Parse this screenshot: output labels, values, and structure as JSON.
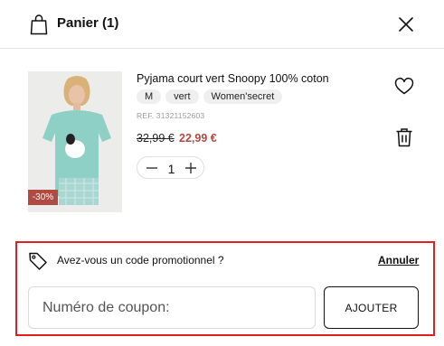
{
  "cart": {
    "title": "Panier (1)"
  },
  "item": {
    "name": "Pyjama court vert Snoopy 100% coton",
    "tags": [
      "M",
      "vert",
      "Women'secret"
    ],
    "ref": "REF. 31321152603",
    "price_old": "32,99 €",
    "price_new": "22,99 €",
    "discount": "-30%",
    "quantity": "1"
  },
  "promo": {
    "question": "Avez-vous un code promotionnel ?",
    "cancel_label": "Annuler",
    "coupon_placeholder": "Numéro de coupon:",
    "add_label": "AJOUTER"
  },
  "colors": {
    "sale_red": "#b04a42",
    "highlight_border": "#e02020"
  },
  "icons": [
    "bag-icon",
    "close-icon",
    "heart-icon",
    "trash-icon",
    "minus-icon",
    "plus-icon",
    "price-tag-icon"
  ]
}
